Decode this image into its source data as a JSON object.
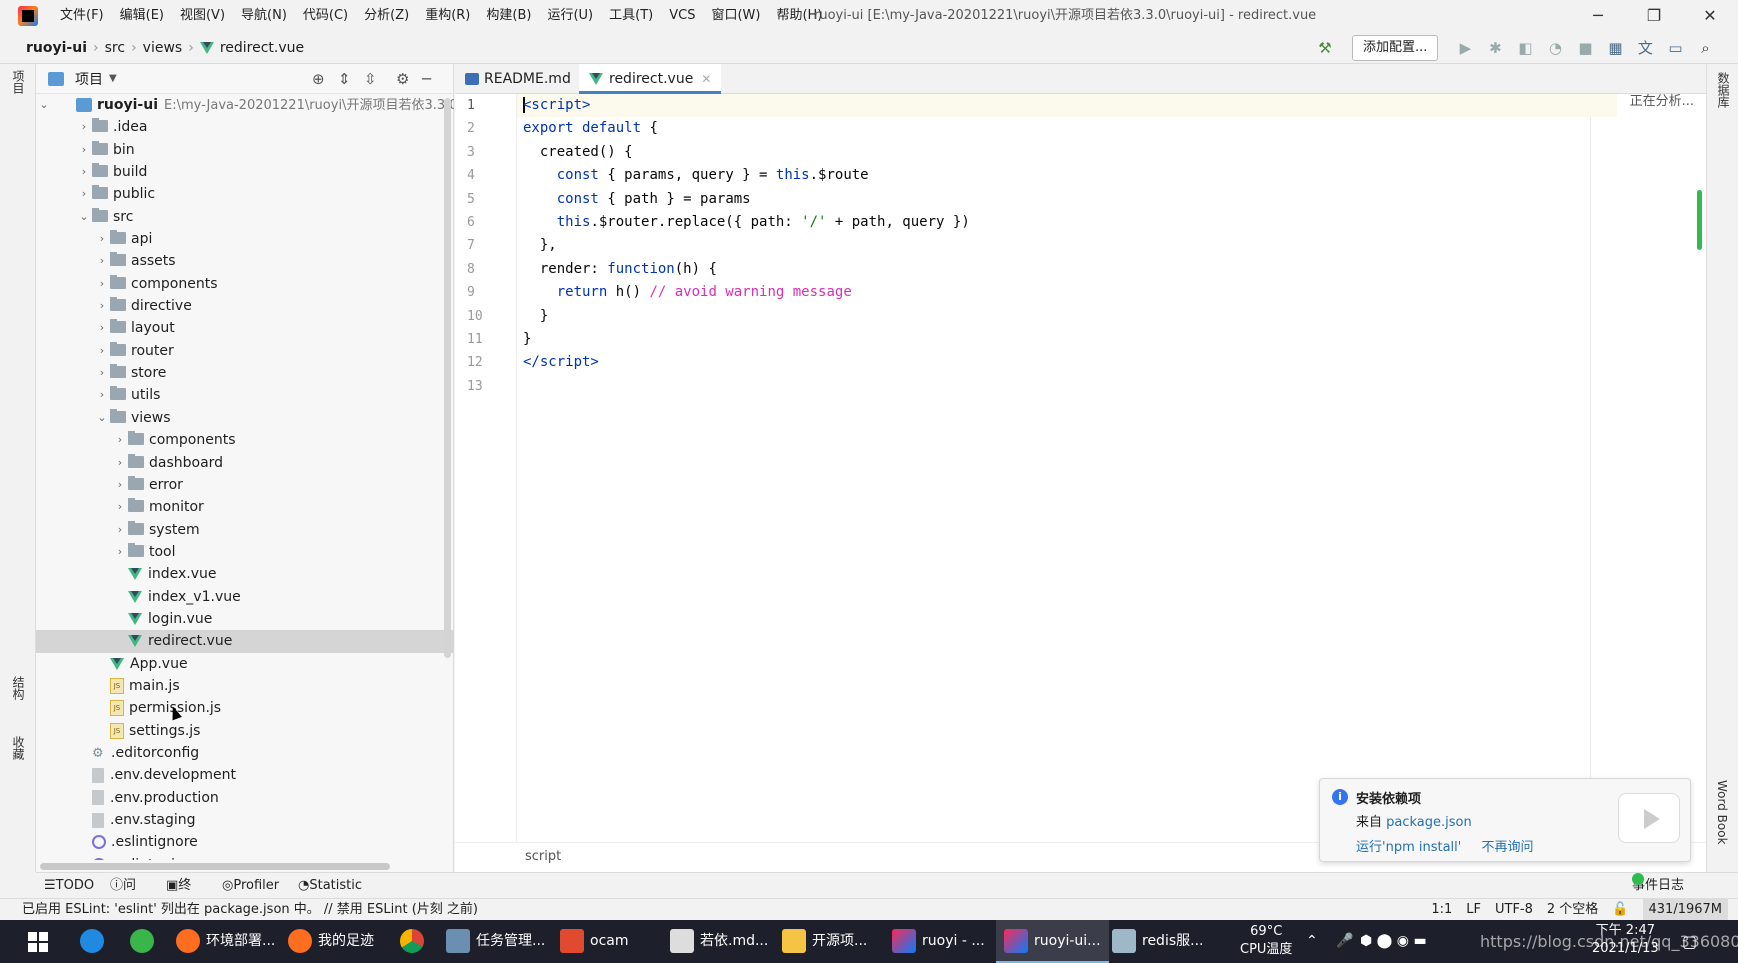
{
  "app": {
    "menu": [
      "文件(F)",
      "编辑(E)",
      "视图(V)",
      "导航(N)",
      "代码(C)",
      "分析(Z)",
      "重构(R)",
      "构建(B)",
      "运行(U)",
      "工具(T)",
      "VCS",
      "窗口(W)",
      "帮助(H)"
    ],
    "window_title": "ruoyi-ui [E:\\my-Java-20201221\\ruoyi\\开源项目若依3.3.0\\ruoyi-ui] - redirect.vue"
  },
  "breadcrumb": [
    "ruoyi-ui",
    "src",
    "views",
    "redirect.vue"
  ],
  "toolbar": {
    "add_config": "添加配置..."
  },
  "left_strip": {
    "project": "项目",
    "structure": "结构",
    "favorites": "收藏"
  },
  "right_strip": {
    "database": "数据库",
    "wordbook": "Word Book"
  },
  "project_panel": {
    "title": "项目",
    "root_name": "ruoyi-ui",
    "root_path": "E:\\my-Java-20201221\\ruoyi\\开源项目若依3.3.0\\ru",
    "tree": [
      {
        "label": ".idea",
        "depth": 1,
        "kind": "folder",
        "state": "collapsed"
      },
      {
        "label": "bin",
        "depth": 1,
        "kind": "folder",
        "state": "collapsed"
      },
      {
        "label": "build",
        "depth": 1,
        "kind": "folder",
        "state": "collapsed"
      },
      {
        "label": "public",
        "depth": 1,
        "kind": "folder",
        "state": "collapsed"
      },
      {
        "label": "src",
        "depth": 1,
        "kind": "folder",
        "state": "expanded"
      },
      {
        "label": "api",
        "depth": 2,
        "kind": "folder",
        "state": "collapsed"
      },
      {
        "label": "assets",
        "depth": 2,
        "kind": "folder",
        "state": "collapsed"
      },
      {
        "label": "components",
        "depth": 2,
        "kind": "folder",
        "state": "collapsed"
      },
      {
        "label": "directive",
        "depth": 2,
        "kind": "folder",
        "state": "collapsed"
      },
      {
        "label": "layout",
        "depth": 2,
        "kind": "folder",
        "state": "collapsed"
      },
      {
        "label": "router",
        "depth": 2,
        "kind": "folder",
        "state": "collapsed"
      },
      {
        "label": "store",
        "depth": 2,
        "kind": "folder",
        "state": "collapsed"
      },
      {
        "label": "utils",
        "depth": 2,
        "kind": "folder",
        "state": "collapsed"
      },
      {
        "label": "views",
        "depth": 2,
        "kind": "folder",
        "state": "expanded"
      },
      {
        "label": "components",
        "depth": 3,
        "kind": "folder",
        "state": "collapsed"
      },
      {
        "label": "dashboard",
        "depth": 3,
        "kind": "folder",
        "state": "collapsed"
      },
      {
        "label": "error",
        "depth": 3,
        "kind": "folder",
        "state": "collapsed"
      },
      {
        "label": "monitor",
        "depth": 3,
        "kind": "folder",
        "state": "collapsed"
      },
      {
        "label": "system",
        "depth": 3,
        "kind": "folder",
        "state": "collapsed"
      },
      {
        "label": "tool",
        "depth": 3,
        "kind": "folder",
        "state": "collapsed"
      },
      {
        "label": "index.vue",
        "depth": 3,
        "kind": "vue"
      },
      {
        "label": "index_v1.vue",
        "depth": 3,
        "kind": "vue"
      },
      {
        "label": "login.vue",
        "depth": 3,
        "kind": "vue"
      },
      {
        "label": "redirect.vue",
        "depth": 3,
        "kind": "vue",
        "selected": true
      },
      {
        "label": "App.vue",
        "depth": 2,
        "kind": "vue"
      },
      {
        "label": "main.js",
        "depth": 2,
        "kind": "js"
      },
      {
        "label": "permission.js",
        "depth": 2,
        "kind": "js"
      },
      {
        "label": "settings.js",
        "depth": 2,
        "kind": "js"
      },
      {
        "label": ".editorconfig",
        "depth": 1,
        "kind": "gear"
      },
      {
        "label": ".env.development",
        "depth": 1,
        "kind": "file"
      },
      {
        "label": ".env.production",
        "depth": 1,
        "kind": "file"
      },
      {
        "label": ".env.staging",
        "depth": 1,
        "kind": "file"
      },
      {
        "label": ".eslintignore",
        "depth": 1,
        "kind": "eslint"
      },
      {
        "label": ".eslintrc.js",
        "depth": 1,
        "kind": "eslint"
      }
    ]
  },
  "editor": {
    "tabs": [
      {
        "label": "README.md",
        "active": false
      },
      {
        "label": "redirect.vue",
        "active": true
      }
    ],
    "analyzing": "正在分析...",
    "line_numbers": [
      "1",
      "2",
      "3",
      "4",
      "5",
      "6",
      "7",
      "8",
      "9",
      "10",
      "11",
      "12",
      "13"
    ],
    "footer_crumb": "script"
  },
  "notification": {
    "title": "安装依赖项",
    "from_prefix": "来自 ",
    "from_link": "package.json",
    "action_install": "运行'npm install'",
    "action_dismiss": "不再询问"
  },
  "tool_windows": [
    "TODO",
    "问题",
    "终端",
    "Profiler",
    "Statistic"
  ],
  "status_bar": {
    "message": "已启用 ESLint: 'eslint' 列出在 package.json 中。 // 禁用 ESLint (片刻 之前)",
    "position": "1:1",
    "line_sep": "LF",
    "encoding": "UTF-8",
    "indent": "2 个空格",
    "memory": "431/1967M"
  },
  "taskbar": {
    "apps": [
      {
        "label": "环境部署..."
      },
      {
        "label": "我的足迹"
      },
      {
        "label": "任务管理..."
      },
      {
        "label": "ocam"
      },
      {
        "label": "若依.md..."
      },
      {
        "label": "开源项..."
      },
      {
        "label": "ruoyi - ..."
      },
      {
        "label": "ruoyi-ui..."
      },
      {
        "label": "redis服..."
      }
    ],
    "temp_value": "69°C",
    "temp_label": "CPU温度",
    "watermark": "https://blog.csdn.net/qq_33608000",
    "time": "下午 2:47",
    "date": "2021/1/13"
  },
  "colors": {
    "accent": "#4083c9",
    "vue_green": "#41b883",
    "keyword": "#0033b3",
    "string": "#067d17",
    "comment": "#d92fb6",
    "taskbar": "#1d1f2a"
  }
}
